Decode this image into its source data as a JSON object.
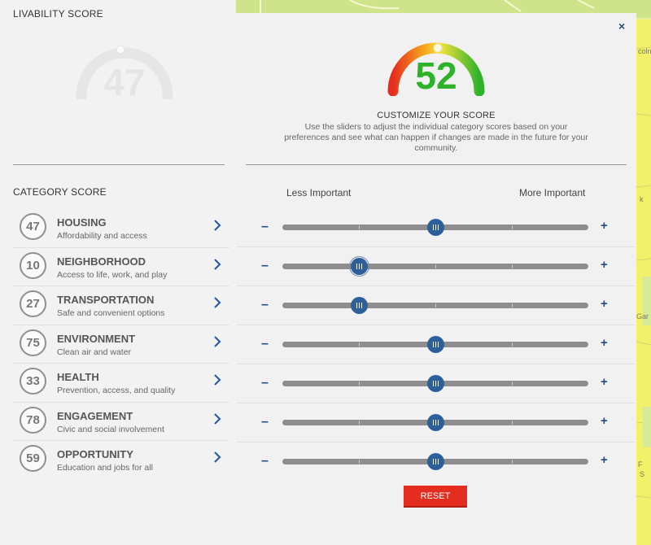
{
  "left": {
    "title": "LIVABILITY SCORE",
    "score": "47",
    "category_title": "CATEGORY SCORE",
    "categories": [
      {
        "score": "47",
        "name": "HOUSING",
        "desc": "Affordability and access"
      },
      {
        "score": "10",
        "name": "NEIGHBORHOOD",
        "desc": "Access to life, work, and play"
      },
      {
        "score": "27",
        "name": "TRANSPORTATION",
        "desc": "Safe and convenient options"
      },
      {
        "score": "75",
        "name": "ENVIRONMENT",
        "desc": "Clean air and water"
      },
      {
        "score": "33",
        "name": "HEALTH",
        "desc": "Prevention, access, and quality"
      },
      {
        "score": "78",
        "name": "ENGAGEMENT",
        "desc": "Civic and social involvement"
      },
      {
        "score": "59",
        "name": "OPPORTUNITY",
        "desc": "Education and jobs for all"
      }
    ]
  },
  "map": {
    "labels": [
      "coln",
      "k",
      "Gar",
      "F",
      "S"
    ]
  },
  "modal": {
    "close": "×",
    "score": "52",
    "title": "CUSTOMIZE YOUR SCORE",
    "desc": "Use the sliders to adjust the individual category scores based on your preferences and see what can happen if changes are made in the future for your community.",
    "less_label": "Less Important",
    "more_label": "More Important",
    "minus": "–",
    "plus": "+",
    "reset_label": "RESET",
    "slider_levels": [
      0.5,
      0.25,
      0.25,
      0.5,
      0.5,
      0.5,
      0.5
    ]
  },
  "colors": {
    "accent_blue": "#2d5f9a",
    "score_green": "#2eb22a",
    "reset_red": "#e52d1f"
  }
}
